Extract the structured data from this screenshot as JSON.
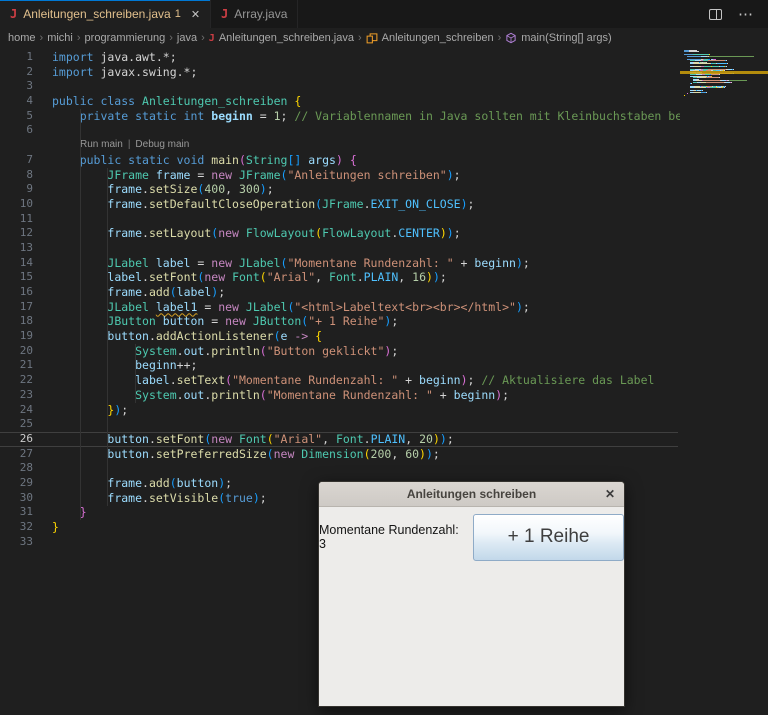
{
  "theme": {
    "editor_bg": "#1f1f1f",
    "tabbar_bg": "#181818",
    "active_tab_border": "#0078d4",
    "modified_file_color": "#e2c08d",
    "warning_color": "#d5a022",
    "tokens": {
      "k": "#569cd6",
      "kc": "#c586c0",
      "t": "#4ec9b0",
      "v": "#9cdcfe",
      "vb": "#9cdcfe",
      "vw": "#9cdcfe",
      "fn": "#dcdcaa",
      "s": "#ce9178",
      "n": "#b5cea8",
      "c": "#6a9955",
      "p": "#d4d4d4",
      "cn": "#4fc1ff",
      "b1": "#ffd700",
      "b2": "#da70d6",
      "b3": "#179fff"
    }
  },
  "tabs": [
    {
      "label": "Anleitungen_schreiben.java",
      "badge": "1",
      "close": "✕",
      "active": true
    },
    {
      "label": "Array.java",
      "active": false
    }
  ],
  "tab_actions": {
    "more": "⋯"
  },
  "breadcrumb": [
    {
      "label": "home"
    },
    {
      "label": "michi"
    },
    {
      "label": "programmierung"
    },
    {
      "label": "java"
    },
    {
      "label": "Anleitungen_schreiben.java",
      "icon": "java-file-icon"
    },
    {
      "label": "Anleitungen_schreiben",
      "icon": "class-icon"
    },
    {
      "label": "main(String[] args)",
      "icon": "method-icon"
    }
  ],
  "editor": {
    "codelens": {
      "run": "Run main",
      "sep": "|",
      "debug": "Debug main"
    },
    "current_line": 26,
    "warning_line": 17,
    "lines": [
      {
        "n": 1,
        "tokens": [
          [
            "k",
            "import "
          ],
          [
            "p",
            "java.awt.*;"
          ]
        ]
      },
      {
        "n": 2,
        "tokens": [
          [
            "k",
            "import "
          ],
          [
            "p",
            "javax.swing.*;"
          ]
        ]
      },
      {
        "n": 3,
        "tokens": []
      },
      {
        "n": 4,
        "tokens": [
          [
            "k",
            "public class "
          ],
          [
            "t",
            "Anleitungen_schreiben "
          ],
          [
            "b1",
            "{"
          ]
        ]
      },
      {
        "n": 5,
        "tokens": [
          [
            "p",
            "    "
          ],
          [
            "k",
            "private static int "
          ],
          [
            "vb",
            "beginn "
          ],
          [
            "p",
            "= "
          ],
          [
            "n",
            "1"
          ],
          [
            "p",
            "; "
          ],
          [
            "c",
            "// Variablennamen in Java sollten mit Kleinbuchstaben beginnen"
          ]
        ]
      },
      {
        "n": 6,
        "tokens": []
      },
      {
        "n": 7,
        "codelens": true,
        "tokens": [
          [
            "p",
            "    "
          ],
          [
            "k",
            "public static void "
          ],
          [
            "fn",
            "main"
          ],
          [
            "b2",
            "("
          ],
          [
            "t",
            "String"
          ],
          [
            "b3",
            "[]"
          ],
          [
            "p",
            " "
          ],
          [
            "v",
            "args"
          ],
          [
            "b2",
            ") "
          ],
          [
            "b2",
            "{"
          ]
        ]
      },
      {
        "n": 8,
        "tokens": [
          [
            "p",
            "        "
          ],
          [
            "t",
            "JFrame "
          ],
          [
            "v",
            "frame "
          ],
          [
            "p",
            "= "
          ],
          [
            "kc",
            "new "
          ],
          [
            "t",
            "JFrame"
          ],
          [
            "b3",
            "("
          ],
          [
            "s",
            "\"Anleitungen schreiben\""
          ],
          [
            "b3",
            ")"
          ],
          [
            "p",
            ";"
          ]
        ]
      },
      {
        "n": 9,
        "tokens": [
          [
            "p",
            "        "
          ],
          [
            "v",
            "frame"
          ],
          [
            "p",
            "."
          ],
          [
            "fn",
            "setSize"
          ],
          [
            "b3",
            "("
          ],
          [
            "n",
            "400"
          ],
          [
            "p",
            ", "
          ],
          [
            "n",
            "300"
          ],
          [
            "b3",
            ")"
          ],
          [
            "p",
            ";"
          ]
        ]
      },
      {
        "n": 10,
        "tokens": [
          [
            "p",
            "        "
          ],
          [
            "v",
            "frame"
          ],
          [
            "p",
            "."
          ],
          [
            "fn",
            "setDefaultCloseOperation"
          ],
          [
            "b3",
            "("
          ],
          [
            "t",
            "JFrame"
          ],
          [
            "p",
            "."
          ],
          [
            "cn",
            "EXIT_ON_CLOSE"
          ],
          [
            "b3",
            ")"
          ],
          [
            "p",
            ";"
          ]
        ]
      },
      {
        "n": 11,
        "tokens": []
      },
      {
        "n": 12,
        "tokens": [
          [
            "p",
            "        "
          ],
          [
            "v",
            "frame"
          ],
          [
            "p",
            "."
          ],
          [
            "fn",
            "setLayout"
          ],
          [
            "b3",
            "("
          ],
          [
            "kc",
            "new "
          ],
          [
            "t",
            "FlowLayout"
          ],
          [
            "b1",
            "("
          ],
          [
            "t",
            "FlowLayout"
          ],
          [
            "p",
            "."
          ],
          [
            "cn",
            "CENTER"
          ],
          [
            "b1",
            ")"
          ],
          [
            "b3",
            ")"
          ],
          [
            "p",
            ";"
          ]
        ]
      },
      {
        "n": 13,
        "tokens": []
      },
      {
        "n": 14,
        "tokens": [
          [
            "p",
            "        "
          ],
          [
            "t",
            "JLabel "
          ],
          [
            "v",
            "label "
          ],
          [
            "p",
            "= "
          ],
          [
            "kc",
            "new "
          ],
          [
            "t",
            "JLabel"
          ],
          [
            "b3",
            "("
          ],
          [
            "s",
            "\"Momentane Rundenzahl: \""
          ],
          [
            "p",
            " + "
          ],
          [
            "v",
            "beginn"
          ],
          [
            "b3",
            ")"
          ],
          [
            "p",
            ";"
          ]
        ]
      },
      {
        "n": 15,
        "tokens": [
          [
            "p",
            "        "
          ],
          [
            "v",
            "label"
          ],
          [
            "p",
            "."
          ],
          [
            "fn",
            "setFont"
          ],
          [
            "b3",
            "("
          ],
          [
            "kc",
            "new "
          ],
          [
            "t",
            "Font"
          ],
          [
            "b1",
            "("
          ],
          [
            "s",
            "\"Arial\""
          ],
          [
            "p",
            ", "
          ],
          [
            "t",
            "Font"
          ],
          [
            "p",
            "."
          ],
          [
            "cn",
            "PLAIN"
          ],
          [
            "p",
            ", "
          ],
          [
            "n",
            "16"
          ],
          [
            "b1",
            ")"
          ],
          [
            "b3",
            ")"
          ],
          [
            "p",
            ";"
          ]
        ]
      },
      {
        "n": 16,
        "tokens": [
          [
            "p",
            "        "
          ],
          [
            "v",
            "frame"
          ],
          [
            "p",
            "."
          ],
          [
            "fn",
            "add"
          ],
          [
            "b3",
            "("
          ],
          [
            "v",
            "label"
          ],
          [
            "b3",
            ")"
          ],
          [
            "p",
            ";"
          ]
        ]
      },
      {
        "n": 17,
        "tokens": [
          [
            "p",
            "        "
          ],
          [
            "t",
            "JLabel "
          ],
          [
            "vw",
            "label1"
          ],
          [
            "p",
            " = "
          ],
          [
            "kc",
            "new "
          ],
          [
            "t",
            "JLabel"
          ],
          [
            "b3",
            "("
          ],
          [
            "s",
            "\"<html>Labeltext<br><br></html>\""
          ],
          [
            "b3",
            ")"
          ],
          [
            "p",
            ";"
          ]
        ]
      },
      {
        "n": 18,
        "tokens": [
          [
            "p",
            "        "
          ],
          [
            "t",
            "JButton "
          ],
          [
            "v",
            "button "
          ],
          [
            "p",
            "= "
          ],
          [
            "kc",
            "new "
          ],
          [
            "t",
            "JButton"
          ],
          [
            "b3",
            "("
          ],
          [
            "s",
            "\"+ 1 Reihe\""
          ],
          [
            "b3",
            ")"
          ],
          [
            "p",
            ";"
          ]
        ]
      },
      {
        "n": 19,
        "tokens": [
          [
            "p",
            "        "
          ],
          [
            "v",
            "button"
          ],
          [
            "p",
            "."
          ],
          [
            "fn",
            "addActionListener"
          ],
          [
            "b3",
            "("
          ],
          [
            "v",
            "e "
          ],
          [
            "kc",
            "-> "
          ],
          [
            "b1",
            "{"
          ]
        ]
      },
      {
        "n": 20,
        "tokens": [
          [
            "p",
            "            "
          ],
          [
            "t",
            "System"
          ],
          [
            "p",
            "."
          ],
          [
            "v",
            "out"
          ],
          [
            "p",
            "."
          ],
          [
            "fn",
            "println"
          ],
          [
            "b2",
            "("
          ],
          [
            "s",
            "\"Button geklickt\""
          ],
          [
            "b2",
            ")"
          ],
          [
            "p",
            ";"
          ]
        ]
      },
      {
        "n": 21,
        "tokens": [
          [
            "p",
            "            "
          ],
          [
            "v",
            "beginn"
          ],
          [
            "p",
            "++;"
          ]
        ]
      },
      {
        "n": 22,
        "tokens": [
          [
            "p",
            "            "
          ],
          [
            "v",
            "label"
          ],
          [
            "p",
            "."
          ],
          [
            "fn",
            "setText"
          ],
          [
            "b2",
            "("
          ],
          [
            "s",
            "\"Momentane Rundenzahl: \""
          ],
          [
            "p",
            " + "
          ],
          [
            "v",
            "beginn"
          ],
          [
            "b2",
            ")"
          ],
          [
            "p",
            "; "
          ],
          [
            "c",
            "// Aktualisiere das Label"
          ]
        ]
      },
      {
        "n": 23,
        "tokens": [
          [
            "p",
            "            "
          ],
          [
            "t",
            "System"
          ],
          [
            "p",
            "."
          ],
          [
            "v",
            "out"
          ],
          [
            "p",
            "."
          ],
          [
            "fn",
            "println"
          ],
          [
            "b2",
            "("
          ],
          [
            "s",
            "\"Momentane Rundenzahl: \""
          ],
          [
            "p",
            " + "
          ],
          [
            "v",
            "beginn"
          ],
          [
            "b2",
            ")"
          ],
          [
            "p",
            ";"
          ]
        ]
      },
      {
        "n": 24,
        "tokens": [
          [
            "p",
            "        "
          ],
          [
            "b1",
            "}"
          ],
          [
            "b3",
            ")"
          ],
          [
            "p",
            ";"
          ]
        ]
      },
      {
        "n": 25,
        "tokens": []
      },
      {
        "n": 26,
        "current": true,
        "tokens": [
          [
            "p",
            "        "
          ],
          [
            "v",
            "button"
          ],
          [
            "p",
            "."
          ],
          [
            "fn",
            "setFont"
          ],
          [
            "b3",
            "("
          ],
          [
            "kc",
            "new "
          ],
          [
            "t",
            "Font"
          ],
          [
            "b1",
            "("
          ],
          [
            "s",
            "\"Arial\""
          ],
          [
            "p",
            ", "
          ],
          [
            "t",
            "Font"
          ],
          [
            "p",
            "."
          ],
          [
            "cn",
            "PLAIN"
          ],
          [
            "p",
            ", "
          ],
          [
            "n",
            "20"
          ],
          [
            "b1",
            ")"
          ],
          [
            "b3",
            ")"
          ],
          [
            "p",
            ";"
          ]
        ]
      },
      {
        "n": 27,
        "tokens": [
          [
            "p",
            "        "
          ],
          [
            "v",
            "button"
          ],
          [
            "p",
            "."
          ],
          [
            "fn",
            "setPreferredSize"
          ],
          [
            "b3",
            "("
          ],
          [
            "kc",
            "new "
          ],
          [
            "t",
            "Dimension"
          ],
          [
            "b1",
            "("
          ],
          [
            "n",
            "200"
          ],
          [
            "p",
            ", "
          ],
          [
            "n",
            "60"
          ],
          [
            "b1",
            ")"
          ],
          [
            "b3",
            ")"
          ],
          [
            "p",
            ";"
          ]
        ]
      },
      {
        "n": 28,
        "tokens": []
      },
      {
        "n": 29,
        "tokens": [
          [
            "p",
            "        "
          ],
          [
            "v",
            "frame"
          ],
          [
            "p",
            "."
          ],
          [
            "fn",
            "add"
          ],
          [
            "b3",
            "("
          ],
          [
            "v",
            "button"
          ],
          [
            "b3",
            ")"
          ],
          [
            "p",
            ";"
          ]
        ]
      },
      {
        "n": 30,
        "tokens": [
          [
            "p",
            "        "
          ],
          [
            "v",
            "frame"
          ],
          [
            "p",
            "."
          ],
          [
            "fn",
            "setVisible"
          ],
          [
            "b3",
            "("
          ],
          [
            "k",
            "true"
          ],
          [
            "b3",
            ")"
          ],
          [
            "p",
            ";"
          ]
        ]
      },
      {
        "n": 31,
        "tokens": [
          [
            "p",
            "    "
          ],
          [
            "b2",
            "}"
          ]
        ]
      },
      {
        "n": 32,
        "tokens": [
          [
            "b1",
            "}"
          ]
        ]
      },
      {
        "n": 33,
        "tokens": []
      }
    ]
  },
  "swing_window": {
    "title": "Anleitungen schreiben",
    "close": "✕",
    "label": "Momentane Rundenzahl: 3",
    "button": "+ 1 Reihe"
  }
}
